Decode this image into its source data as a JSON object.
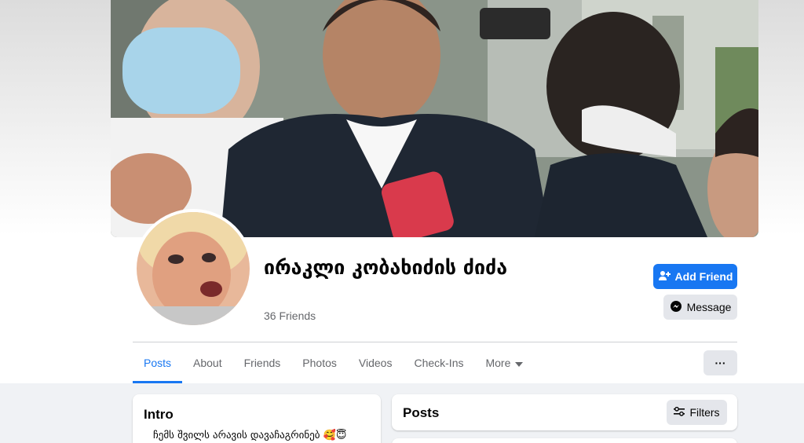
{
  "profile": {
    "name": "ირაკლი კობახიძის ძიძა",
    "friends_count": "36 Friends"
  },
  "actions": {
    "add_friend": "Add Friend",
    "message": "Message"
  },
  "tabs": [
    {
      "label": "Posts",
      "active": true
    },
    {
      "label": "About"
    },
    {
      "label": "Friends"
    },
    {
      "label": "Photos"
    },
    {
      "label": "Videos"
    },
    {
      "label": "Check-Ins"
    },
    {
      "label": "More"
    }
  ],
  "more_menu_label": "···",
  "intro": {
    "title": "Intro",
    "bio": "ჩემს შვილს არავის დავაჩაგრინებ 🥰😇"
  },
  "posts": {
    "title": "Posts",
    "filters_label": "Filters"
  },
  "colors": {
    "accent": "#1877f2",
    "page_bg": "#f0f2f5",
    "button_grey": "#e4e6eb",
    "text_secondary": "#65676b"
  }
}
